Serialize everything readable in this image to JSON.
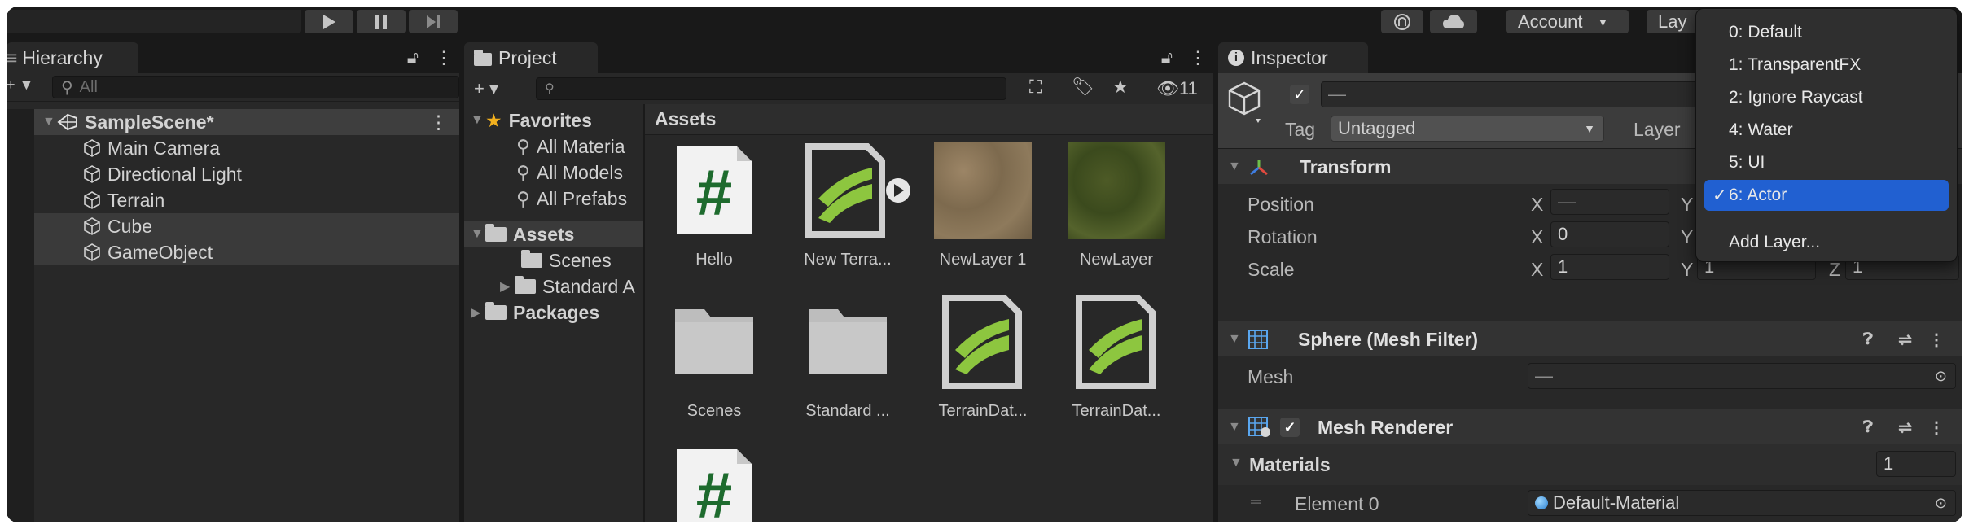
{
  "toolbar": {
    "play_icon": "play-icon",
    "pause_icon": "pause-icon",
    "step_icon": "step-icon",
    "account_label": "Account",
    "layers_label": "Lay"
  },
  "hierarchy": {
    "tab_label": "Hierarchy",
    "search_placeholder": "All",
    "scene_name": "SampleScene*",
    "items": [
      "Main Camera",
      "Directional Light",
      "Terrain",
      "Cube",
      "GameObject"
    ]
  },
  "project": {
    "tab_label": "Project",
    "hidden_count": "11",
    "tree": {
      "favorites_label": "Favorites",
      "favorites": [
        "All Materia",
        "All Models",
        "All Prefabs"
      ],
      "assets_label": "Assets",
      "assets_children": [
        "Scenes",
        "Standard A"
      ],
      "packages_label": "Packages"
    },
    "grid_title": "Assets",
    "assets": [
      {
        "name": "Hello",
        "kind": "script"
      },
      {
        "name": "New Terra...",
        "kind": "terrain-layer"
      },
      {
        "name": "NewLayer 1",
        "kind": "texture-sand"
      },
      {
        "name": "NewLayer",
        "kind": "texture-grass"
      },
      {
        "name": "Scenes",
        "kind": "folder"
      },
      {
        "name": "Standard ...",
        "kind": "folder"
      },
      {
        "name": "TerrainDat...",
        "kind": "terrain-data"
      },
      {
        "name": "TerrainDat...",
        "kind": "terrain-data"
      },
      {
        "name": "",
        "kind": "script"
      }
    ]
  },
  "inspector": {
    "tab_label": "Inspector",
    "object_name": "—",
    "tag_label": "Tag",
    "tag_value": "Untagged",
    "layer_label": "Layer",
    "transform": {
      "title": "Transform",
      "position_label": "Position",
      "rotation_label": "Rotation",
      "scale_label": "Scale",
      "x": "X",
      "y": "Y",
      "z": "Z",
      "position_x": "—",
      "rotation_x": "0",
      "scale_x": "1",
      "scale_y": "1",
      "scale_z": "1"
    },
    "mesh_filter": {
      "title": "Sphere (Mesh Filter)",
      "mesh_label": "Mesh",
      "mesh_value": "—"
    },
    "mesh_renderer": {
      "title": "Mesh Renderer",
      "materials_label": "Materials",
      "materials_count": "1",
      "element_label": "Element 0",
      "element_value": "Default-Material"
    }
  },
  "layer_dropdown": {
    "items": [
      "0: Default",
      "1: TransparentFX",
      "2: Ignore Raycast",
      "4: Water",
      "5: UI",
      "6: Actor"
    ],
    "selected": "6: Actor",
    "check": "✓",
    "add_layer": "Add Layer..."
  },
  "colors": {
    "selection": "#2160d1",
    "terrain_green": "#8dc63f",
    "script_green": "#1e6b2e"
  }
}
